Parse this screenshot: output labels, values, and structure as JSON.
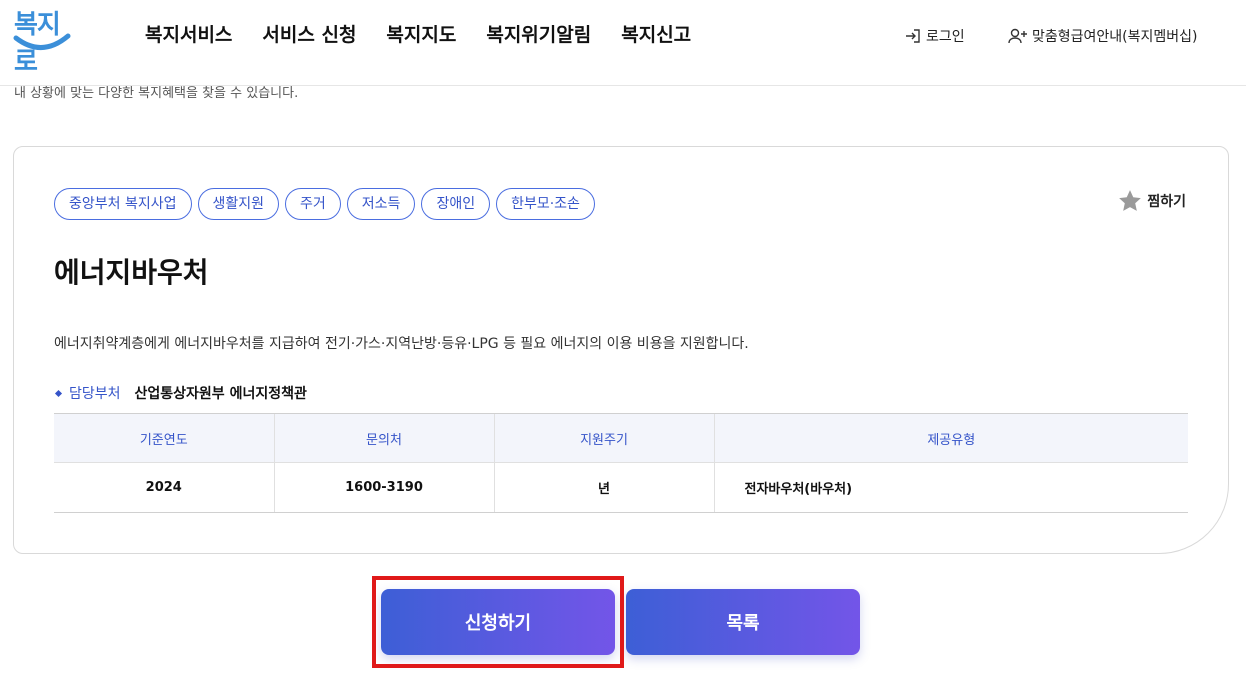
{
  "header": {
    "logo_text": "복지로",
    "nav": [
      "복지서비스",
      "서비스 신청",
      "복지지도",
      "복지위기알림",
      "복지신고"
    ],
    "login_label": "로그인",
    "member_label": "맞춤형급여안내(복지멤버십)"
  },
  "intro_text": "내 상황에 맞는 다양한 복지혜택을 찾을 수 있습니다.",
  "service": {
    "tags": [
      "중앙부처 복지사업",
      "생활지원",
      "주거",
      "저소득",
      "장애인",
      "한부모·조손"
    ],
    "favorite_label": "찜하기",
    "title": "에너지바우처",
    "description": "에너지취약계층에게 에너지바우처를 지급하여 전기·가스·지역난방·등유·LPG 등 필요 에너지의 이용 비용을 지원합니다.",
    "dept_label": "담당부처",
    "dept_value": "산업통상자원부 에너지정책관",
    "table": {
      "headers": [
        "기준연도",
        "문의처",
        "지원주기",
        "제공유형"
      ],
      "row": [
        "2024",
        "1600-3190",
        "년",
        "전자바우처(바우처)"
      ]
    }
  },
  "buttons": {
    "apply": "신청하기",
    "list": "목록"
  },
  "colors": {
    "accent": "#3554c9",
    "button_start": "#3d5fd6",
    "button_end": "#7355e8",
    "highlight": "#e01919"
  }
}
